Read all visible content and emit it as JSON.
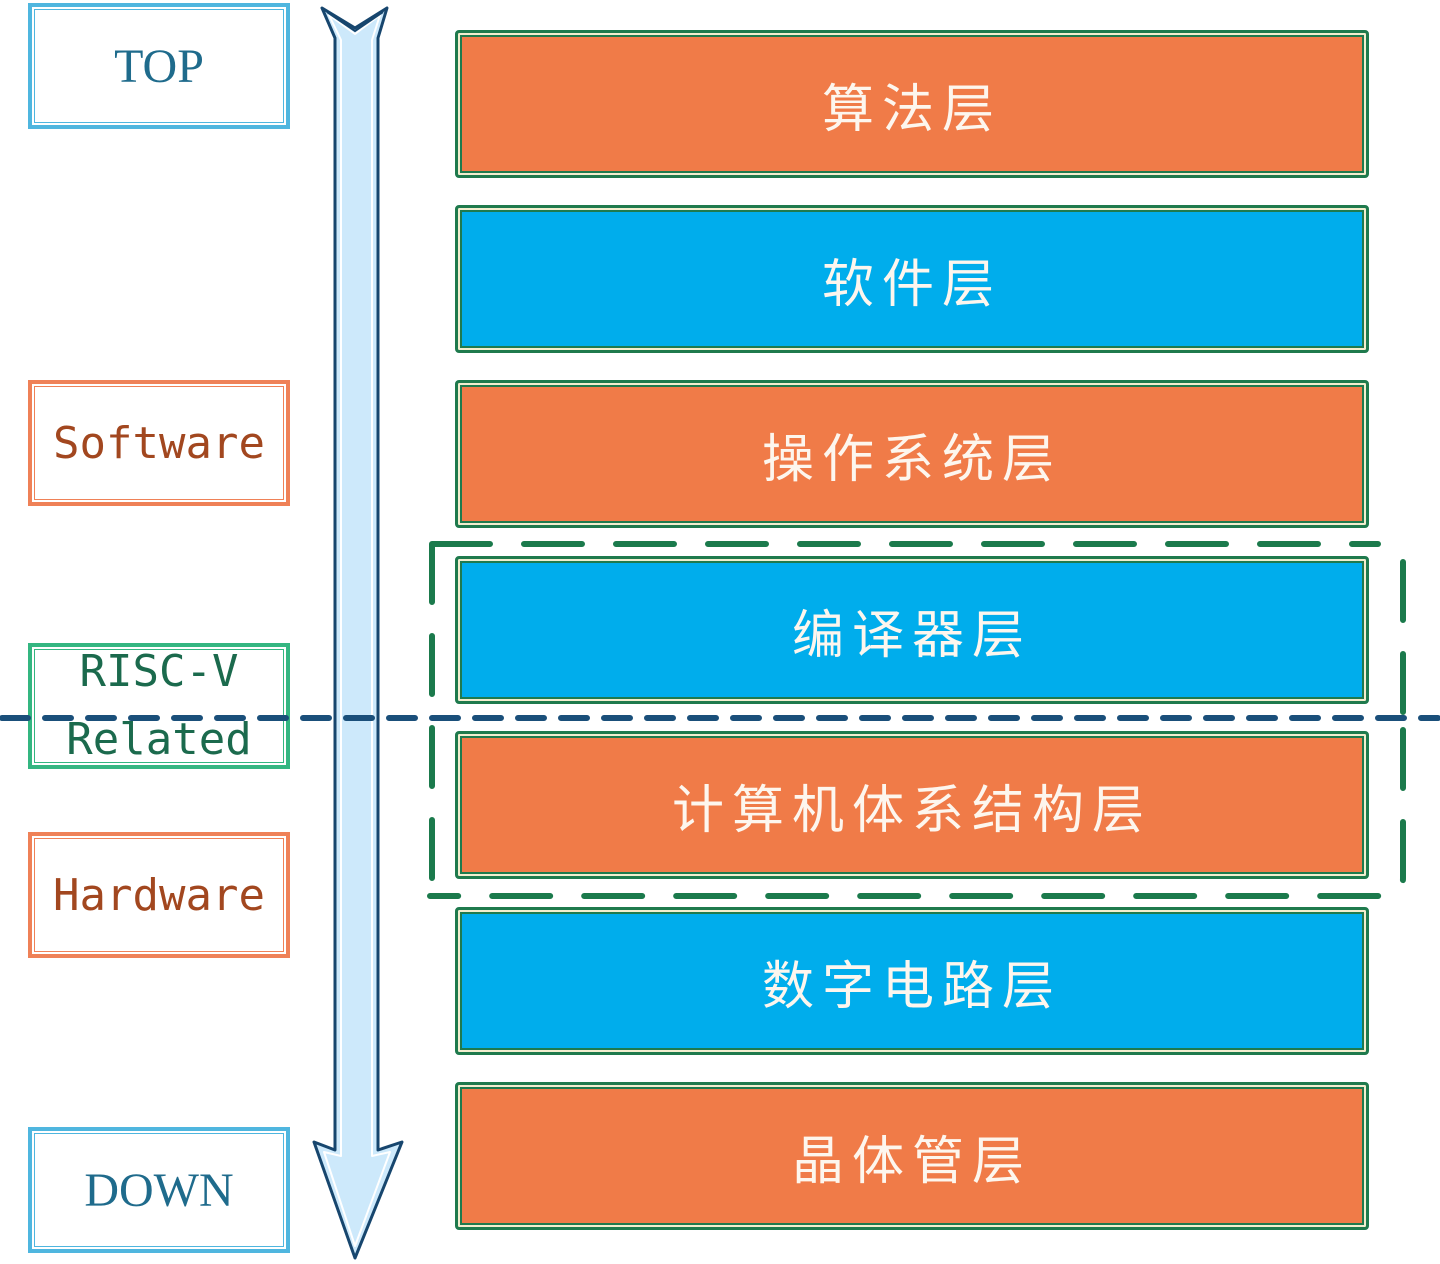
{
  "diagram": {
    "side_labels": {
      "top": "TOP",
      "software": "Software",
      "risc_v_line1": "RISC-V",
      "risc_v_line2": "Related",
      "hardware": "Hardware",
      "down": "DOWN"
    },
    "layers": [
      {
        "label": "算法层",
        "color": "#f07b48"
      },
      {
        "label": "软件层",
        "color": "#00adec"
      },
      {
        "label": "操作系统层",
        "color": "#f07b48"
      },
      {
        "label": "编译器层",
        "color": "#00adec"
      },
      {
        "label": "计算机体系结构层",
        "color": "#f07b48"
      },
      {
        "label": "数字电路层",
        "color": "#00adec"
      },
      {
        "label": "晶体管层",
        "color": "#f07b48"
      }
    ],
    "arrow": {
      "direction": "down",
      "meaning": "top-to-down abstraction"
    },
    "highlight_group": {
      "covers": [
        "编译器层",
        "计算机体系结构层"
      ],
      "color": "#1f7a4d"
    },
    "divider": {
      "meaning": "software / hardware boundary",
      "color": "#1a4f7a"
    }
  }
}
